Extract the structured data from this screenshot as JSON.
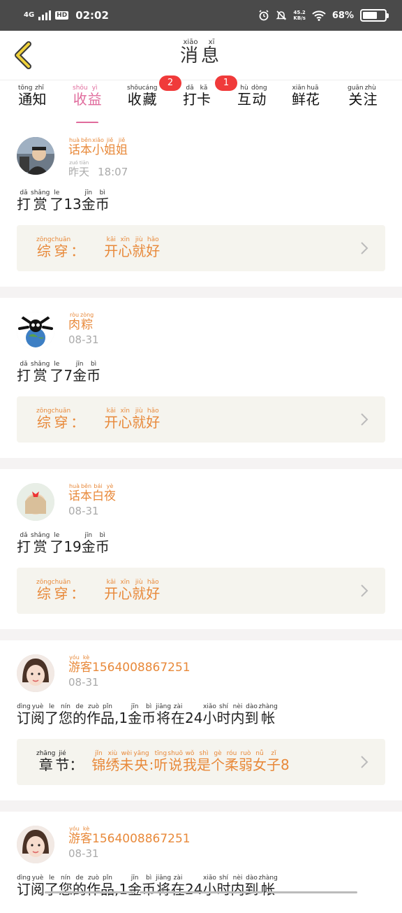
{
  "status_bar": {
    "network": "4G",
    "hd": "HD",
    "time": "02:02",
    "speed_value": "45.2",
    "speed_unit": "KB/s",
    "battery": "68%"
  },
  "header": {
    "title_chars": [
      "消",
      "息"
    ],
    "title_pinyin": [
      "xiāo",
      "xī"
    ]
  },
  "tabs": [
    {
      "chars": [
        "通",
        "知"
      ],
      "pinyin": [
        "tōng",
        "zhī"
      ],
      "badge": "",
      "active": false
    },
    {
      "chars": [
        "收",
        "益"
      ],
      "pinyin": [
        "shōu",
        "yì"
      ],
      "badge": "",
      "active": true
    },
    {
      "chars": [
        "收",
        "藏"
      ],
      "pinyin": [
        "shōu",
        "cáng"
      ],
      "badge": "2",
      "active": false
    },
    {
      "chars": [
        "打",
        "卡"
      ],
      "pinyin": [
        "dǎ",
        "kǎ"
      ],
      "badge": "1",
      "active": false
    },
    {
      "chars": [
        "互",
        "动"
      ],
      "pinyin": [
        "hù",
        "dòng"
      ],
      "badge": "",
      "active": false
    },
    {
      "chars": [
        "鲜",
        "花"
      ],
      "pinyin": [
        "xiān",
        "huā"
      ],
      "badge": "",
      "active": false
    },
    {
      "chars": [
        "关",
        "注"
      ],
      "pinyin": [
        "guān",
        "zhù"
      ],
      "badge": "",
      "active": false
    }
  ],
  "items": [
    {
      "user": {
        "chars": [
          "话",
          "本",
          "小",
          "姐",
          "姐"
        ],
        "pinyin": [
          "huà",
          "běn",
          "xiǎo",
          "jiě",
          "jiě"
        ],
        "suffix": ""
      },
      "time_chars": [
        "昨",
        "天"
      ],
      "time_pinyin": [
        "zuó",
        "tiān"
      ],
      "time": "18:07",
      "message": {
        "parts": [
          [
            "打",
            "dǎ"
          ],
          [
            "赏",
            "shǎng"
          ],
          [
            "了",
            "le"
          ],
          [
            "13",
            ""
          ],
          [
            "金",
            "jīn"
          ],
          [
            "币",
            "bì"
          ]
        ]
      },
      "box_label": [
        [
          "综",
          "zōng"
        ],
        [
          "穿",
          "chuān"
        ],
        [
          "：",
          ""
        ]
      ],
      "box_text": [
        [
          "开",
          "kāi"
        ],
        [
          "心",
          "xīn"
        ],
        [
          "就",
          "jiù"
        ],
        [
          "好",
          "hǎo"
        ]
      ],
      "avatar": "man-in-car-avatar"
    },
    {
      "user": {
        "chars": [
          "肉",
          "粽"
        ],
        "pinyin": [
          "ròu",
          "zòng"
        ],
        "suffix": ""
      },
      "time_chars": [],
      "time_pinyin": [],
      "time": "08-31",
      "message": {
        "parts": [
          [
            "打",
            "dǎ"
          ],
          [
            "赏",
            "shǎng"
          ],
          [
            "了",
            "le"
          ],
          [
            "7",
            ""
          ],
          [
            "金",
            "jīn"
          ],
          [
            "币",
            "bì"
          ]
        ]
      },
      "box_label": [
        [
          "综",
          "zōng"
        ],
        [
          "穿",
          "chuān"
        ],
        [
          "：",
          ""
        ]
      ],
      "box_text": [
        [
          "开",
          "kāi"
        ],
        [
          "心",
          "xīn"
        ],
        [
          "就",
          "jiù"
        ],
        [
          "好",
          "hǎo"
        ]
      ],
      "avatar": "skull-globe-avatar"
    },
    {
      "user": {
        "chars": [
          "话",
          "本",
          "白",
          "夜"
        ],
        "pinyin": [
          "huà",
          "běn",
          "bái",
          "yè"
        ],
        "suffix": ""
      },
      "time_chars": [],
      "time_pinyin": [],
      "time": "08-31",
      "message": {
        "parts": [
          [
            "打",
            "dǎ"
          ],
          [
            "赏",
            "shǎng"
          ],
          [
            "了",
            "le"
          ],
          [
            "19",
            ""
          ],
          [
            "金",
            "jīn"
          ],
          [
            "币",
            "bì"
          ]
        ]
      },
      "box_label": [
        [
          "综",
          "zōng"
        ],
        [
          "穿",
          "chuān"
        ],
        [
          "：",
          ""
        ]
      ],
      "box_text": [
        [
          "开",
          "kāi"
        ],
        [
          "心",
          "xīn"
        ],
        [
          "就",
          "jiù"
        ],
        [
          "好",
          "hǎo"
        ]
      ],
      "avatar": "girl-hairbow-avatar"
    },
    {
      "user": {
        "chars": [
          "游",
          "客"
        ],
        "pinyin": [
          "yóu",
          "kè"
        ],
        "suffix": "1564008867251"
      },
      "time_chars": [],
      "time_pinyin": [],
      "time": "08-31",
      "message": {
        "parts": [
          [
            "订",
            "dìng"
          ],
          [
            "阅",
            "yuè"
          ],
          [
            "了",
            "le"
          ],
          [
            "您",
            "nín"
          ],
          [
            "的",
            "de"
          ],
          [
            "作",
            "zuò"
          ],
          [
            "品",
            "pǐn"
          ],
          [
            ",1",
            ""
          ],
          [
            "金",
            "jīn"
          ],
          [
            "币",
            "bì"
          ],
          [
            "将",
            "jiāng"
          ],
          [
            "在",
            "zài"
          ],
          [
            "24",
            ""
          ],
          [
            "小",
            "xiǎo"
          ],
          [
            "时",
            "shí"
          ],
          [
            "内",
            "nèi"
          ],
          [
            "到",
            "dào"
          ],
          [
            "帐",
            "zhàng"
          ]
        ]
      },
      "box_label": [
        [
          "章",
          "zhāng"
        ],
        [
          "节",
          "jié"
        ],
        [
          "：",
          ""
        ]
      ],
      "box_text": [
        [
          "锦",
          "jǐn"
        ],
        [
          "绣",
          "xiù"
        ],
        [
          "未",
          "wèi"
        ],
        [
          "央",
          "yāng"
        ],
        [
          ":",
          ""
        ],
        [
          "听",
          "tīng"
        ],
        [
          "说",
          "shuō"
        ],
        [
          "我",
          "wǒ"
        ],
        [
          "是",
          "shì"
        ],
        [
          "个",
          "gè"
        ],
        [
          "柔",
          "róu"
        ],
        [
          "弱",
          "ruò"
        ],
        [
          "女",
          "nǚ"
        ],
        [
          "子",
          "zǐ"
        ],
        [
          "8",
          ""
        ]
      ],
      "avatar": "girl-face-avatar"
    },
    {
      "user": {
        "chars": [
          "游",
          "客"
        ],
        "pinyin": [
          "yóu",
          "kè"
        ],
        "suffix": "1564008867251"
      },
      "time_chars": [],
      "time_pinyin": [],
      "time": "08-31",
      "message": {
        "parts": [
          [
            "订",
            "dìng"
          ],
          [
            "阅",
            "yuè"
          ],
          [
            "了",
            "le"
          ],
          [
            "您",
            "nín"
          ],
          [
            "的",
            "de"
          ],
          [
            "作",
            "zuò"
          ],
          [
            "品",
            "pǐn"
          ],
          [
            ",1",
            ""
          ],
          [
            "金",
            "jīn"
          ],
          [
            "币",
            "bì"
          ],
          [
            "将",
            "jiāng"
          ],
          [
            "在",
            "zài"
          ],
          [
            "24",
            ""
          ],
          [
            "小",
            "xiǎo"
          ],
          [
            "时",
            "shí"
          ],
          [
            "内",
            "nèi"
          ],
          [
            "到",
            "dào"
          ],
          [
            "帐",
            "zhàng"
          ]
        ]
      },
      "box_label": [],
      "box_text": [],
      "avatar": "girl-face-avatar"
    }
  ],
  "colors": {
    "accent_pink": "#e06b9c",
    "accent_orange": "#e8893a",
    "badge_red": "#f03a3a"
  }
}
